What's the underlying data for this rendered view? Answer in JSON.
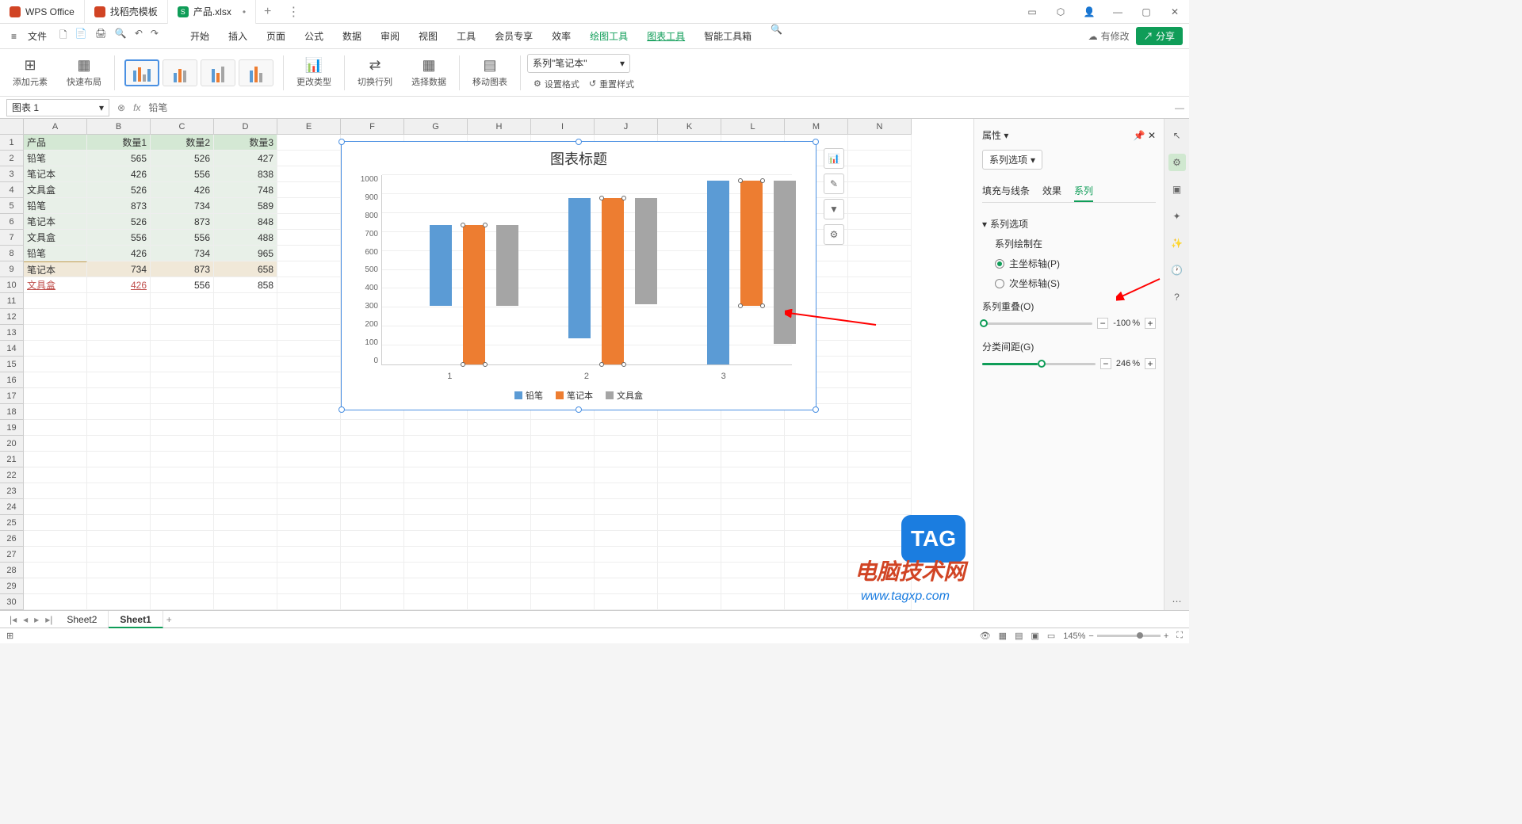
{
  "titlebar": {
    "tab1": "WPS Office",
    "tab2": "找稻壳模板",
    "tab3": "产品.xlsx"
  },
  "menubar": {
    "file": "文件",
    "items": [
      "开始",
      "插入",
      "页面",
      "公式",
      "数据",
      "审阅",
      "视图",
      "工具",
      "会员专享",
      "效率",
      "绘图工具",
      "图表工具",
      "智能工具箱"
    ]
  },
  "right_menu": {
    "modify": "有修改",
    "share": "分享"
  },
  "ribbon": {
    "add_element": "添加元素",
    "quick_layout": "快速布局",
    "change_type": "更改类型",
    "switch_rowcol": "切换行列",
    "select_data": "选择数据",
    "move_chart": "移动图表",
    "series_select": "系列\"笔记本\"",
    "set_format": "设置格式",
    "reset_style": "重置样式"
  },
  "formula": {
    "namebox": "图表 1",
    "text": "铅笔"
  },
  "columns": [
    "A",
    "B",
    "C",
    "D",
    "E",
    "F",
    "G",
    "H",
    "I",
    "J",
    "K",
    "L",
    "M",
    "N"
  ],
  "table": {
    "headers": [
      "产品",
      "数量1",
      "数量2",
      "数量3"
    ],
    "rows": [
      [
        "铅笔",
        "565",
        "526",
        "427"
      ],
      [
        "笔记本",
        "426",
        "556",
        "838"
      ],
      [
        "文具盒",
        "526",
        "426",
        "748"
      ],
      [
        "铅笔",
        "873",
        "734",
        "589"
      ],
      [
        "笔记本",
        "526",
        "873",
        "848"
      ],
      [
        "文具盒",
        "556",
        "556",
        "488"
      ],
      [
        "铅笔",
        "426",
        "734",
        "965"
      ],
      [
        "笔记本",
        "734",
        "873",
        "658"
      ],
      [
        "文具盒",
        "426",
        "556",
        "858"
      ]
    ]
  },
  "chart_data": {
    "type": "bar",
    "title": "图表标题",
    "categories": [
      "1",
      "2",
      "3"
    ],
    "series": [
      {
        "name": "铅笔",
        "values": [
          427,
          734,
          965
        ],
        "color": "#5b9bd5"
      },
      {
        "name": "笔记本",
        "values": [
          734,
          873,
          658
        ],
        "color": "#ed7d31"
      },
      {
        "name": "文具盒",
        "values": [
          427,
          556,
          858
        ],
        "color": "#a5a5a5"
      }
    ],
    "ylim": [
      0,
      1000
    ],
    "yticks": [
      0,
      100,
      200,
      300,
      400,
      500,
      600,
      700,
      800,
      900,
      1000
    ],
    "legend": [
      "铅笔",
      "笔记本",
      "文具盒"
    ]
  },
  "prop": {
    "title": "属性",
    "series_options": "系列选项",
    "tabs": [
      "填充与线条",
      "效果",
      "系列"
    ],
    "section_series": "系列选项",
    "plot_on": "系列绘制在",
    "primary_axis": "主坐标轴(P)",
    "secondary_axis": "次坐标轴(S)",
    "overlap": "系列重叠(O)",
    "overlap_val": "-100",
    "gap": "分类间距(G)",
    "gap_val": "246",
    "pct": "%"
  },
  "sheets": {
    "s1": "Sheet2",
    "s2": "Sheet1"
  },
  "status": {
    "zoom": "145%"
  },
  "watermark": {
    "text": "电脑技术网",
    "tag": "TAG",
    "url": "www.tagxp.com"
  }
}
